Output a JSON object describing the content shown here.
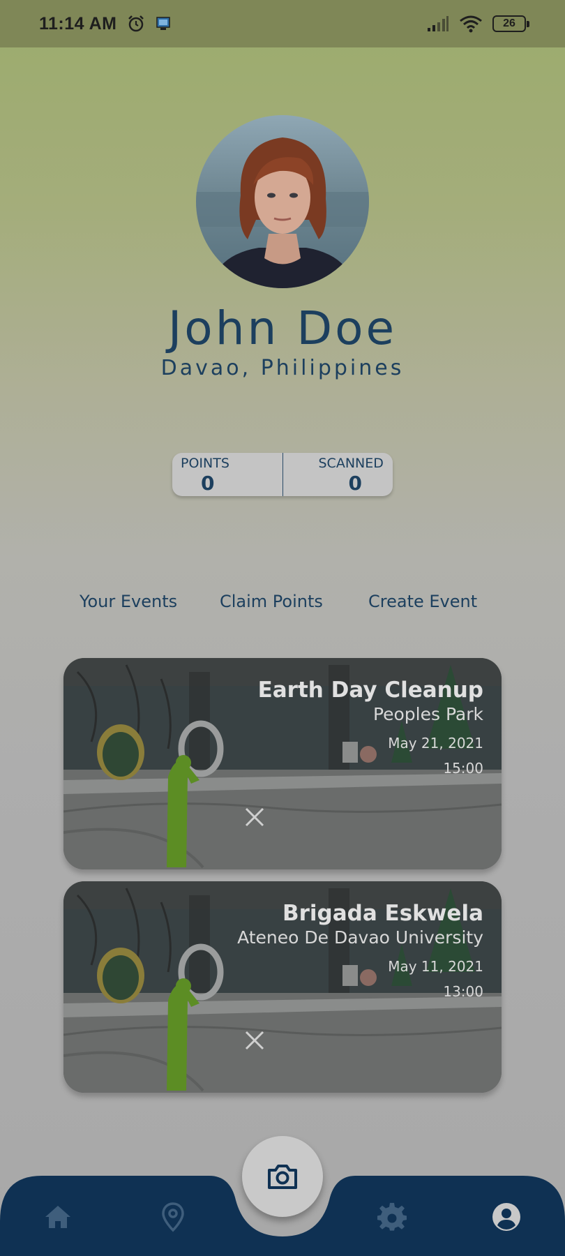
{
  "status_bar": {
    "time": "11:14 AM",
    "battery": "26",
    "icons": [
      "alarm-icon",
      "notification-app-icon",
      "signal-icon",
      "wifi-icon",
      "battery-icon"
    ]
  },
  "profile": {
    "name": "John Doe",
    "location": "Davao, Philippines"
  },
  "stats": [
    {
      "label": "POINTS",
      "value": "0"
    },
    {
      "label": "SCANNED",
      "value": "0"
    }
  ],
  "links": [
    "Your Events",
    "Claim Points",
    "Create Event"
  ],
  "events": [
    {
      "title": "Earth Day Cleanup",
      "place": "Peoples Park",
      "date": "May 21, 2021",
      "time": "15:00"
    },
    {
      "title": "Brigada Eskwela",
      "place": "Ateneo De Davao University",
      "date": "May 11, 2021",
      "time": "13:00"
    }
  ],
  "bottom_nav": {
    "items": [
      "home-icon",
      "location-pin-icon",
      "camera-icon",
      "gear-icon",
      "account-icon"
    ],
    "bar_color": "#0f3153",
    "icon_color": "#3f5e7c",
    "active_icon_color": "#c8c8c8"
  },
  "colors": {
    "text_primary": "#1c3f5e",
    "status_bar": "#7f8757"
  }
}
